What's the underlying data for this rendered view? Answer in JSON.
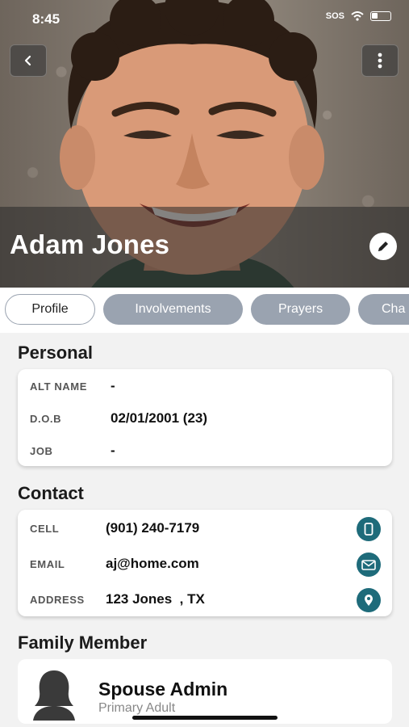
{
  "status_bar": {
    "time": "8:45",
    "carrier": "SOS"
  },
  "profile": {
    "name": "Adam Jones"
  },
  "tabs": [
    {
      "label": "Profile",
      "active": true
    },
    {
      "label": "Involvements",
      "active": false
    },
    {
      "label": "Prayers",
      "active": false
    },
    {
      "label": "Cha",
      "active": false
    }
  ],
  "personal": {
    "title": "Personal",
    "rows": [
      {
        "label": "ALT NAME",
        "value": "-"
      },
      {
        "label": "D.O.B",
        "value": "02/01/2001 (23)"
      },
      {
        "label": "JOB",
        "value": "-"
      }
    ]
  },
  "contact": {
    "title": "Contact",
    "rows": [
      {
        "label": "CELL",
        "value": "(901) 240-7179",
        "icon": "phone-icon"
      },
      {
        "label": "EMAIL",
        "value": "aj@home.com",
        "icon": "mail-icon"
      },
      {
        "label": "ADDRESS",
        "value": "123 Jones  , TX",
        "icon": "location-pin-icon"
      }
    ]
  },
  "family": {
    "title": "Family Member",
    "members": [
      {
        "name": "Spouse Admin",
        "role": "Primary Adult"
      }
    ]
  },
  "colors": {
    "accent": "#1e6b7a",
    "tab_inactive": "#9aa3b0"
  }
}
